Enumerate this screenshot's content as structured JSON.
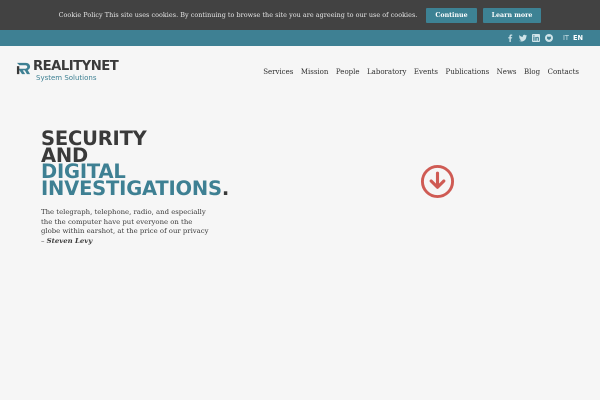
{
  "cookie": {
    "text": "Cookie Policy This site uses cookies. By continuing to browse the site you are agreeing to our use of cookies.",
    "continue_label": "Continue",
    "learn_more_label": "Learn more"
  },
  "topbar": {
    "social_icons": [
      "facebook-icon",
      "twitter-icon",
      "linkedin-icon",
      "github-icon"
    ],
    "lang_it": "IT",
    "lang_en": "EN"
  },
  "logo": {
    "name": "REALITYNET",
    "tagline": "System Solutions"
  },
  "nav": {
    "items": [
      "Services",
      "Mission",
      "People",
      "Laboratory",
      "Events",
      "Publications",
      "News",
      "Blog",
      "Contacts"
    ]
  },
  "hero": {
    "line1": "SECURITY",
    "line2": "AND",
    "line3": "DIGITAL",
    "line4": "INVESTIGATIONS",
    "dot": ".",
    "quote": "The telegraph, telephone, radio, and especially the the computer have put everyone on the globe within earshot, at the price of our privacy –",
    "author": "Steven Levy"
  },
  "colors": {
    "brand_teal": "#3e8093",
    "accent_red": "#cf5b54",
    "dark_text": "#3a3a3a",
    "cookie_bg": "#424242"
  }
}
